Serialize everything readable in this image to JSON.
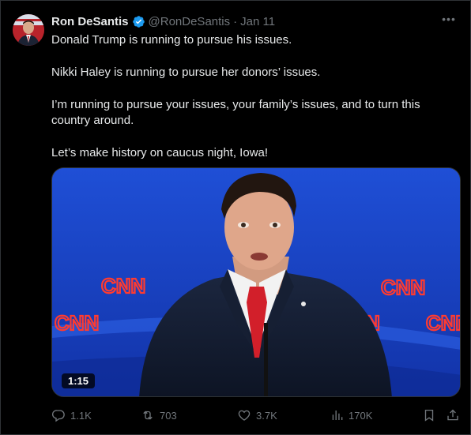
{
  "author": {
    "name": "Ron DeSantis",
    "handle": "@RonDeSantis",
    "separator": "·",
    "date": "Jan 11",
    "verified": true
  },
  "tweet": {
    "lines": [
      "Donald Trump is running to pursue his issues.",
      "Nikki Haley is running to pursue her donors’ issues.",
      "I’m running to pursue your issues, your family’s issues, and to turn this country around.",
      "Let’s make history on caucus night, Iowa!"
    ]
  },
  "media": {
    "duration": "1:15",
    "brand_text": "CNN"
  },
  "stats": {
    "replies": "1.1K",
    "reposts": "703",
    "likes": "3.7K",
    "views": "170K"
  },
  "colors": {
    "background": "#000000",
    "text": "#e7e9ea",
    "muted": "#71767b",
    "verified_badge": "#1d9bf0",
    "stage_blue": "#1a3fc4",
    "cnn_red": "#e4302a"
  }
}
